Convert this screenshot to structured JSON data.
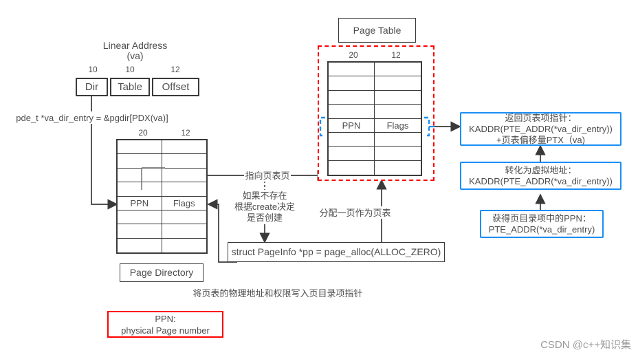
{
  "diagram": {
    "title_linear_address": "Linear Address\n(va)",
    "address_fields": [
      {
        "bits": "10",
        "name": "Dir"
      },
      {
        "bits": "10",
        "name": "Table"
      },
      {
        "bits": "12",
        "name": "Offset"
      }
    ],
    "code_pde": "pde_t *va_dir_entry = &pgdir[PDX(va)]",
    "page_directory": {
      "caption": "Page Directory",
      "col_bits": [
        "20",
        "12"
      ],
      "rows": 8,
      "highlight_row_index": 4,
      "highlight_cells": [
        "PPN",
        "Flags"
      ]
    },
    "page_table": {
      "caption": "Page Table",
      "col_bits": [
        "20",
        "12"
      ],
      "rows": 8,
      "highlight_row_index": 4,
      "highlight_cells": [
        "PPN",
        "Flags"
      ],
      "border_color": "#ff0000",
      "bracket_color": "#1a8ef5"
    },
    "edge_labels": {
      "points_to_page_table_page": "指向页表页",
      "create_decision": "如果不存在\n根据create决定\n是否创建",
      "alloc_one_page": "分配一页作为页表",
      "write_back_pde": "将页表的物理地址和权限写入页目录项指针"
    },
    "code_pagealloc": "struct PageInfo *pp = page_alloc(ALLOC_ZERO)",
    "notes": [
      {
        "id": "return-pte-pointer",
        "text": "返回页表项指针：\nKADDR(PTE_ADDR(*va_dir_entry))\n+页表偏移量PTX（va)",
        "color": "#1a8ef5"
      },
      {
        "id": "to-virtual-address",
        "text": "转化为虚拟地址：\nKADDR(PTE_ADDR(*va_dir_entry))",
        "color": "#1a8ef5"
      },
      {
        "id": "get-ppn-from-pde",
        "text": "获得页目录项中的PPN：\nPTE_ADDR(*va_dir_entry)",
        "color": "#1a8ef5"
      }
    ],
    "legend": {
      "text": "PPN:\nphysical Page number",
      "color": "#ff0000"
    },
    "watermark": "CSDN @c++知识集"
  }
}
